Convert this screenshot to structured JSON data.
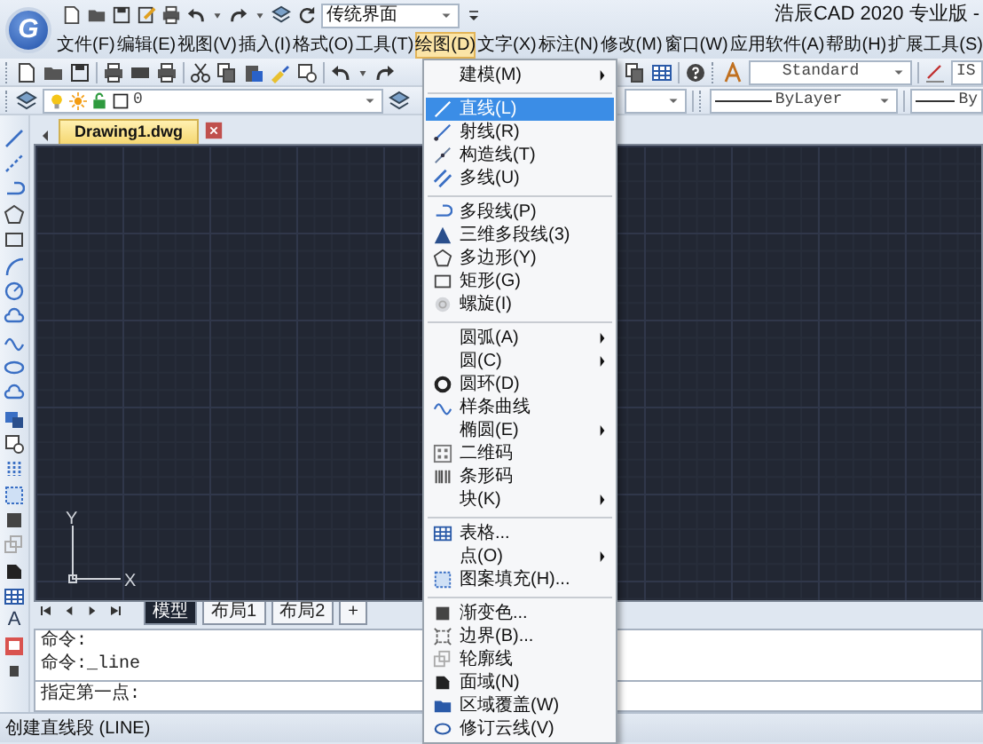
{
  "app": {
    "logo": "G",
    "title": "浩辰CAD 2020 专业版 -"
  },
  "workspace_combo": {
    "value": "传统界面"
  },
  "menu_bar": [
    {
      "label": "文件(F)",
      "selected": false
    },
    {
      "label": "编辑(E)",
      "selected": false
    },
    {
      "label": "视图(V)",
      "selected": false
    },
    {
      "label": "插入(I)",
      "selected": false
    },
    {
      "label": "格式(O)",
      "selected": false
    },
    {
      "label": "工具(T)",
      "selected": false
    },
    {
      "label": "绘图(D)",
      "selected": true
    },
    {
      "label": "文字(X)",
      "selected": false
    },
    {
      "label": "标注(N)",
      "selected": false
    },
    {
      "label": "修改(M)",
      "selected": false
    },
    {
      "label": "窗口(W)",
      "selected": false
    },
    {
      "label": "应用软件(A)",
      "selected": false
    },
    {
      "label": "帮助(H)",
      "selected": false
    },
    {
      "label": "扩展工具(S)",
      "selected": false
    }
  ],
  "toolbar": {
    "text_style": "Standard",
    "dim_style": "IS",
    "layer": "0",
    "linetype": "ByLayer",
    "lineweight": "By"
  },
  "left_toolbar": {
    "text_tool": "A"
  },
  "document_tab": {
    "title": "Drawing1.dwg"
  },
  "ucs": {
    "y_label": "Y",
    "x_label": "X"
  },
  "layout_tabs": [
    {
      "label": "模型",
      "selected": true
    },
    {
      "label": "布局1",
      "selected": false
    },
    {
      "label": "布局2",
      "selected": false
    },
    {
      "label": "+",
      "selected": false
    }
  ],
  "command_history": [
    "命令:",
    "命令:_line"
  ],
  "command_prompt": "指定第一点:",
  "status_bar": {
    "text": "创建直线段 (LINE)"
  },
  "draw_menu": {
    "groups": [
      {
        "items": [
          {
            "label": "建模(M)",
            "submenu": true,
            "selected": false
          }
        ]
      },
      {
        "items": [
          {
            "label": "直线(L)",
            "submenu": false,
            "selected": true
          },
          {
            "label": "射线(R)",
            "submenu": false,
            "selected": false
          },
          {
            "label": "构造线(T)",
            "submenu": false,
            "selected": false
          },
          {
            "label": "多线(U)",
            "submenu": false,
            "selected": false
          }
        ]
      },
      {
        "items": [
          {
            "label": "多段线(P)",
            "submenu": false,
            "selected": false
          },
          {
            "label": "三维多段线(3)",
            "submenu": false,
            "selected": false
          },
          {
            "label": "多边形(Y)",
            "submenu": false,
            "selected": false
          },
          {
            "label": "矩形(G)",
            "submenu": false,
            "selected": false
          },
          {
            "label": "螺旋(I)",
            "submenu": false,
            "selected": false
          }
        ]
      },
      {
        "items": [
          {
            "label": "圆弧(A)",
            "submenu": true,
            "selected": false
          },
          {
            "label": "圆(C)",
            "submenu": true,
            "selected": false
          },
          {
            "label": "圆环(D)",
            "submenu": false,
            "selected": false
          },
          {
            "label": "样条曲线",
            "submenu": false,
            "selected": false
          },
          {
            "label": "椭圆(E)",
            "submenu": true,
            "selected": false
          },
          {
            "label": "二维码",
            "submenu": false,
            "selected": false
          },
          {
            "label": "条形码",
            "submenu": false,
            "selected": false
          },
          {
            "label": "块(K)",
            "submenu": true,
            "selected": false
          }
        ]
      },
      {
        "items": [
          {
            "label": "表格...",
            "submenu": false,
            "selected": false
          },
          {
            "label": "点(O)",
            "submenu": true,
            "selected": false
          },
          {
            "label": "图案填充(H)...",
            "submenu": false,
            "selected": false
          }
        ]
      },
      {
        "items": [
          {
            "label": "渐变色...",
            "submenu": false,
            "selected": false
          },
          {
            "label": "边界(B)...",
            "submenu": false,
            "selected": false
          },
          {
            "label": "轮廓线",
            "submenu": false,
            "selected": false
          },
          {
            "label": "面域(N)",
            "submenu": false,
            "selected": false
          },
          {
            "label": "区域覆盖(W)",
            "submenu": false,
            "selected": false
          },
          {
            "label": "修订云线(V)",
            "submenu": false,
            "selected": false
          }
        ]
      }
    ]
  }
}
